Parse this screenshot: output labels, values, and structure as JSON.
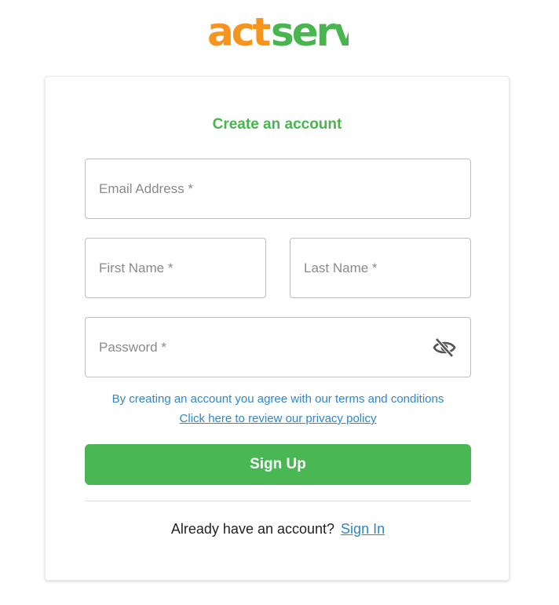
{
  "brand": {
    "logo_part1": "act",
    "logo_part2": "serv",
    "color_orange": "#f7941d",
    "color_green": "#48b54e"
  },
  "form": {
    "title": "Create an account",
    "email_placeholder": "Email Address *",
    "first_name_placeholder": "First Name *",
    "last_name_placeholder": "Last Name *",
    "password_placeholder": "Password *",
    "password_toggle_icon": "eye-off-icon",
    "terms_text": "By creating an account you agree with our terms and conditions",
    "privacy_link": "Click here to review our privacy policy",
    "submit_label": "Sign Up"
  },
  "footer": {
    "prompt": "Already have an account?",
    "signin_link": "Sign In"
  },
  "colors": {
    "accent_green": "#48b754",
    "link_blue": "#2f86c8"
  }
}
